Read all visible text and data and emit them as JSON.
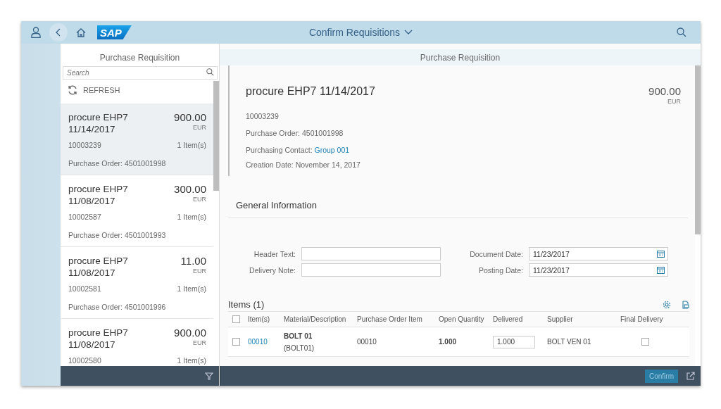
{
  "shell": {
    "logo": "SAP",
    "title": "Confirm Requisitions"
  },
  "master": {
    "title": "Purchase Requisition",
    "search_placeholder": "Search",
    "refresh": "REFRESH",
    "items": [
      {
        "name": "procure EHP7",
        "date": "11/14/2017",
        "amount": "900.00",
        "currency": "EUR",
        "number": "10003239",
        "count": "1 Item(s)",
        "purchase_order": "Purchase Order: 4501001998",
        "selected": true
      },
      {
        "name": "procure EHP7",
        "date": "11/08/2017",
        "amount": "300.00",
        "currency": "EUR",
        "number": "10002587",
        "count": "1 Item(s)",
        "purchase_order": "Purchase Order: 4501001993",
        "selected": false
      },
      {
        "name": "procure EHP7",
        "date": "11/08/2017",
        "amount": "11.00",
        "currency": "EUR",
        "number": "10002581",
        "count": "1 Item(s)",
        "purchase_order": "Purchase Order: 4501001996",
        "selected": false
      },
      {
        "name": "procure EHP7",
        "date": "11/08/2017",
        "amount": "900.00",
        "currency": "EUR",
        "number": "10002580",
        "count": "1 Item(s)",
        "selected": false
      }
    ]
  },
  "detail": {
    "title": "Purchase Requisition",
    "heading": "procure EHP7 11/14/2017",
    "amount": "900.00",
    "currency": "EUR",
    "number": "10003239",
    "attributes": [
      {
        "label": "Purchase Order:",
        "value": "4501001998",
        "link": false
      },
      {
        "label": "Purchasing Contact:",
        "value": "Group 001",
        "link": true
      },
      {
        "label": "Creation Date:",
        "value": "November 14, 2017",
        "link": false
      }
    ],
    "section": "General Information",
    "fields_left": [
      {
        "label": "Header Text:"
      },
      {
        "label": "Delivery Note:"
      }
    ],
    "fields_right": [
      {
        "label": "Document Date:",
        "value": "11/23/2017"
      },
      {
        "label": "Posting Date:",
        "value": "11/23/2017"
      }
    ],
    "items": {
      "title": "Items (1)",
      "select_all": false,
      "columns": [
        "Item(s)",
        "Material/Description",
        "Purchase Order Item",
        "Open Quantity",
        "Delivered",
        "Supplier",
        "Final Delivery"
      ],
      "rows": [
        {
          "item": "00010",
          "material": "BOLT 01",
          "material_id": "(BOLT01)",
          "po_item": "00010",
          "open_quantity": "1.000",
          "delivered": "1.000",
          "supplier": "BOLT VEN 01",
          "final_delivery": false,
          "selected": false
        }
      ]
    },
    "confirm": "Confirm"
  }
}
